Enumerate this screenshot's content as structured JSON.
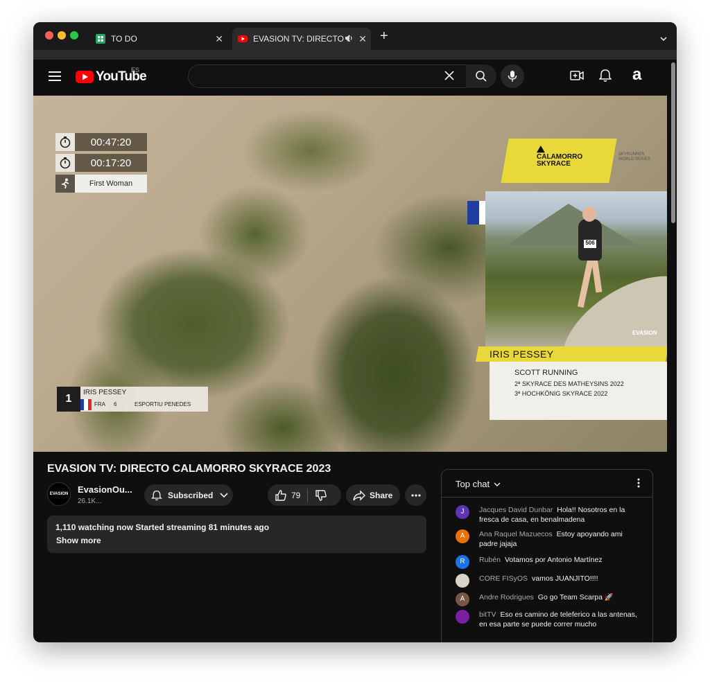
{
  "browser": {
    "tabs": [
      {
        "title": "TO DO"
      },
      {
        "title": "EVASION TV: DIRECTO CAL"
      }
    ]
  },
  "youtube": {
    "logo_text": "YouTube",
    "region": "ES",
    "avatar_letter": "a"
  },
  "overlay": {
    "timer1": "00:47:20",
    "timer2": "00:17:20",
    "category": "First Woman",
    "brand_line1": "CALAMORRO",
    "brand_line2": "SKYRACE",
    "skyrunner": "SKYRUNNER WORLD SERIES",
    "watermark": "EVASION",
    "bib": "506",
    "runner_name": "IRIS PESSEY",
    "team": "SCOTT RUNNING",
    "results": [
      "2ª SKYRACE DES MATHEYSINS 2022",
      "3ª HOCHKÖNIG SKYRACE 2022"
    ],
    "position": {
      "rank": "1",
      "name": "IRIS PESSEY",
      "nat": "FRA",
      "bib": "6",
      "club": "ESPORTIU PENEDES"
    }
  },
  "video": {
    "title": "EVASION TV: DIRECTO CALAMORRO SKYRACE 2023",
    "channel_avatar": "EVASION",
    "channel_name": "EvasionOu...",
    "subscribers": "26.1K...",
    "subscribed_label": "Subscribed",
    "likes": "79",
    "share_label": "Share",
    "description": {
      "stats": "1,110 watching now  Started streaming 81 minutes ago",
      "more": "Show more"
    }
  },
  "chat": {
    "title": "Top chat",
    "messages": [
      {
        "initial": "J",
        "author": "Jacques David Dunbar",
        "text": "Hola!! Nosotros en la fresca de casa, en benalmadena",
        "color": "#5e35b1"
      },
      {
        "initial": "A",
        "author": "Ana Raquel Mazuecos",
        "text": "Estoy apoyando ami padre jajaja",
        "color": "#e8710a"
      },
      {
        "initial": "R",
        "author": "Rubén",
        "text": "Votamos por Antonio Martínez",
        "color": "#1a73e8"
      },
      {
        "initial": "",
        "author": "CORE FISyOS",
        "text": "vamos JUANJITO!!!!",
        "color": "#d8d2c8"
      },
      {
        "initial": "A",
        "author": "Andre Rodrigues",
        "text": "Go go Team Scarpa 🚀",
        "color": "#795548"
      },
      {
        "initial": "",
        "author": "bitTV",
        "text": "Eso es camino de teleferico a las antenas, en esa parte se puede correr mucho",
        "color": "#7b1fa2"
      }
    ]
  }
}
